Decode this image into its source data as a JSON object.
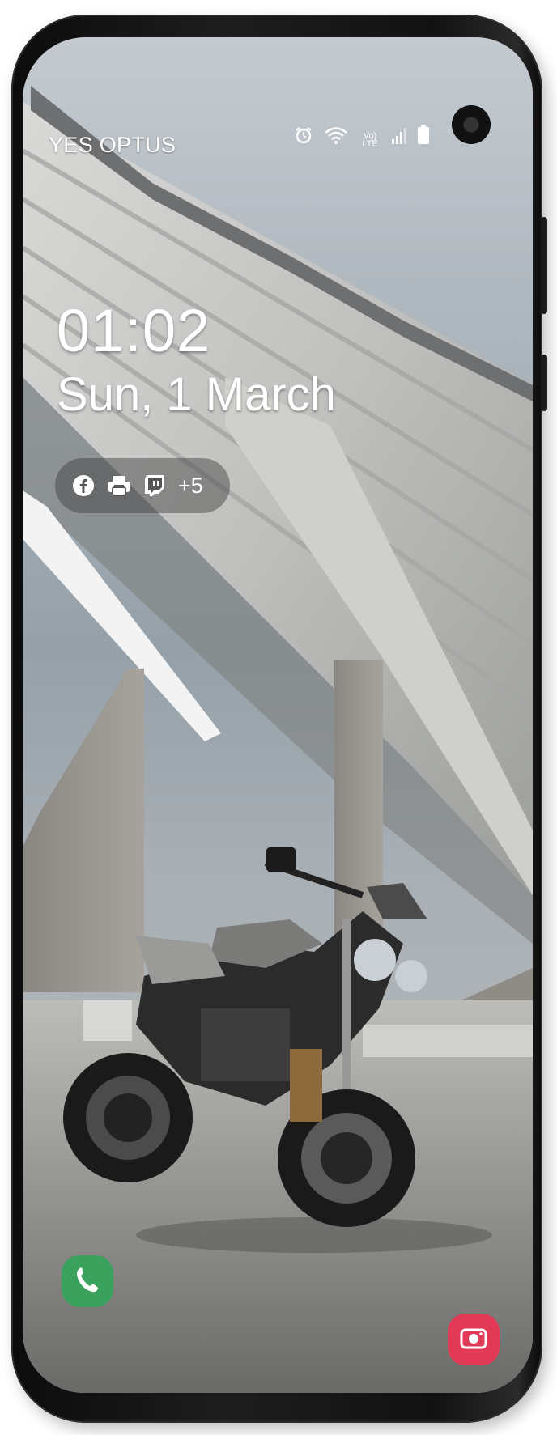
{
  "status_bar": {
    "carrier": "YES OPTUS",
    "icons": [
      "alarm-icon",
      "wifi-icon",
      "volte-icon",
      "signal-icon",
      "battery-icon"
    ],
    "volte_label": "Vo) LTE"
  },
  "lock_screen": {
    "time": "01:02",
    "date": "Sun, 1 March",
    "notification_icons": [
      "facebook-icon",
      "printer-icon",
      "twitch-icon"
    ],
    "more_count": "+5"
  },
  "shortcuts": {
    "left": "phone-icon",
    "right": "camera-icon"
  },
  "colors": {
    "phone_shortcut": "#3aa25c",
    "camera_shortcut": "#e23a56",
    "frame": "#151515"
  }
}
